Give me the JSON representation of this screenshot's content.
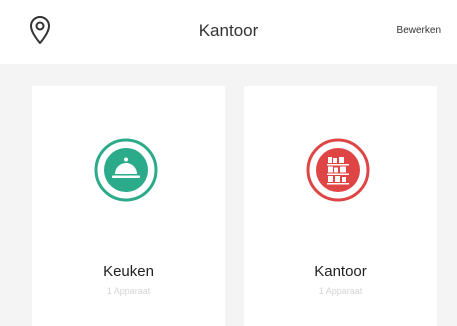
{
  "header": {
    "title": "Kantoor",
    "edit_label": "Bewerken",
    "location_icon": "location-pin-icon"
  },
  "rooms": [
    {
      "name": "Keuken",
      "subtitle": "1 Apparaat",
      "icon": "cloche-icon",
      "color": "#2bab8a"
    },
    {
      "name": "Kantoor",
      "subtitle": "1 Apparaat",
      "icon": "shelves-icon",
      "color": "#e04545"
    }
  ],
  "colors": {
    "background": "#f4f4f4",
    "card": "#ffffff",
    "kitchen_accent": "#2bab8a",
    "office_accent": "#e04545"
  }
}
